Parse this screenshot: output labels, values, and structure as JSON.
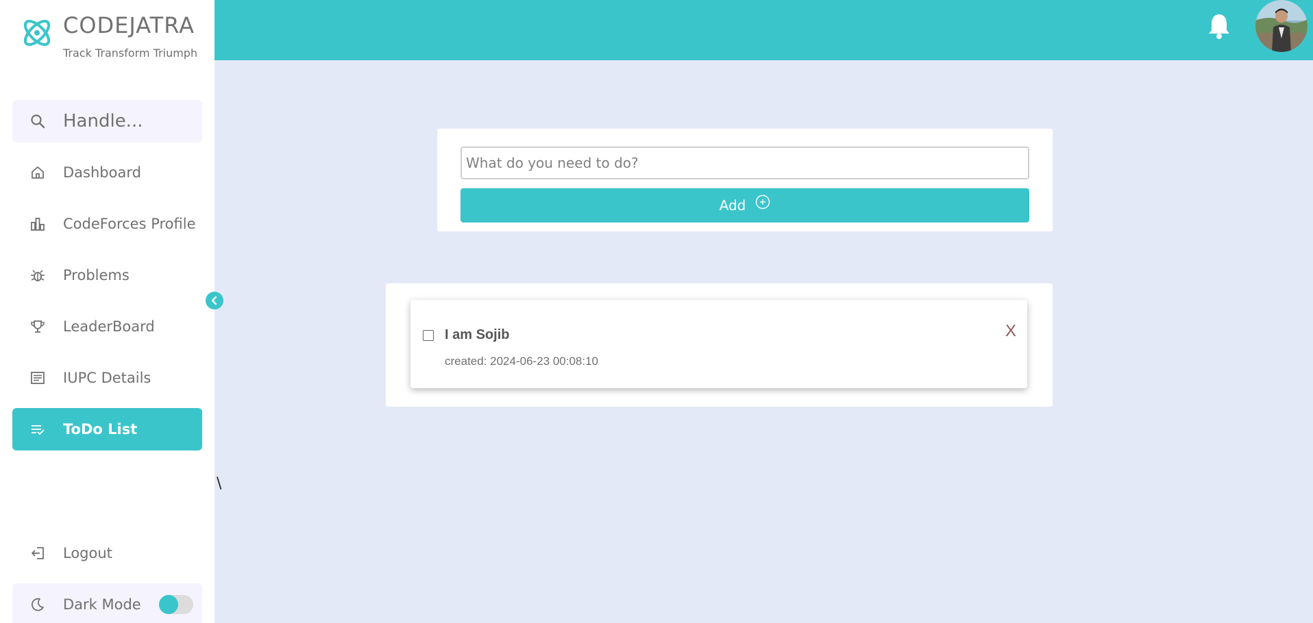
{
  "brand": {
    "name": "CODEJATRA",
    "tagline": "Track Transform Triumph"
  },
  "search": {
    "placeholder": "Handle..."
  },
  "sidebar": {
    "items": [
      {
        "label": "Dashboard",
        "icon": "home-icon"
      },
      {
        "label": "CodeForces Profile",
        "icon": "bar-chart-icon"
      },
      {
        "label": "Problems",
        "icon": "bug-icon"
      },
      {
        "label": "LeaderBoard",
        "icon": "trophy-icon"
      },
      {
        "label": "IUPC Details",
        "icon": "document-icon"
      },
      {
        "label": "ToDo List",
        "icon": "checklist-icon",
        "active": true
      }
    ],
    "logout_label": "Logout",
    "dark_mode_label": "Dark Mode",
    "dark_mode_on": false
  },
  "stray_text": "\\",
  "todo": {
    "input_placeholder": "What do you need to do?",
    "add_label": "Add",
    "items": [
      {
        "title": "I am Sojib",
        "created": "created: 2024-06-23 00:08:10",
        "delete_label": "X",
        "checked": false
      }
    ]
  },
  "colors": {
    "accent": "#3ac5cb",
    "background": "#e4e9f7",
    "sidebar": "#ffffff",
    "text": "#707070"
  }
}
